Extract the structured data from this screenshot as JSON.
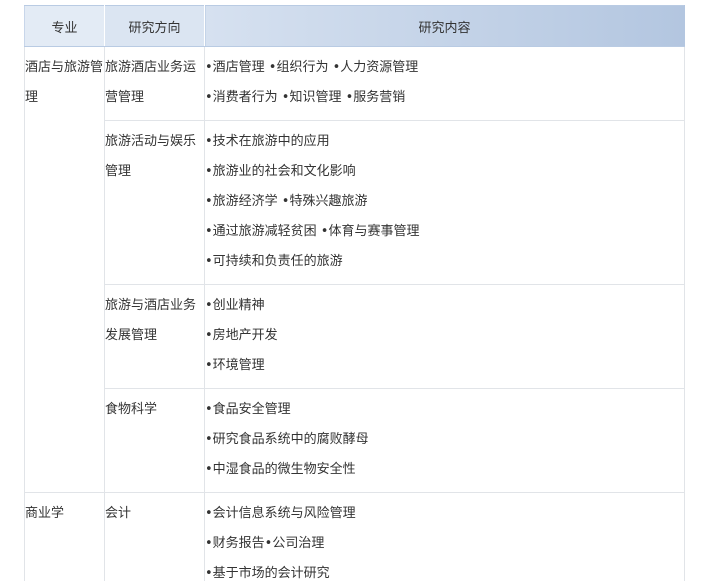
{
  "header": {
    "major": "专业",
    "direction": "研究方向",
    "content": "研究内容"
  },
  "rows": [
    {
      "major": "酒店与旅游管理",
      "direction": "旅游酒店业务运营管理",
      "items": [
        "•酒店管理 •组织行为 •人力资源管理",
        "•消费者行为 •知识管理 •服务营销"
      ]
    },
    {
      "major": "",
      "direction": "旅游活动与娱乐管理",
      "items": [
        "•技术在旅游中的应用",
        "•旅游业的社会和文化影响",
        "•旅游经济学 •特殊兴趣旅游",
        "•通过旅游减轻贫困 •体育与赛事管理",
        "•可持续和负责任的旅游"
      ]
    },
    {
      "major": "",
      "direction": "旅游与酒店业务发展管理",
      "items": [
        "•创业精神",
        "•房地产开发",
        "•环境管理"
      ]
    },
    {
      "major": "",
      "direction": "食物科学",
      "items": [
        "•食品安全管理",
        "•研究食品系统中的腐败酵母",
        "•中湿食品的微生物安全性"
      ]
    },
    {
      "major": "商业学",
      "direction": "会计",
      "items": [
        "•会计信息系统与风险管理",
        "•财务报告•公司治理",
        "•基于市场的会计研究"
      ]
    }
  ]
}
